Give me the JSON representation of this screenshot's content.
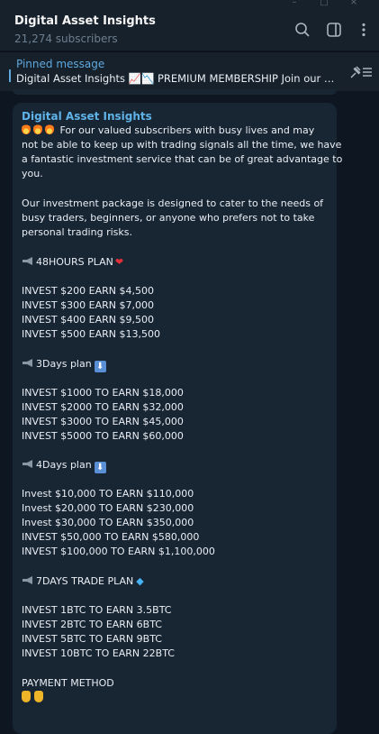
{
  "header": {
    "title": "Digital Asset Insights",
    "subscribers": "21,274 subscribers"
  },
  "pinned": {
    "label": "Pinned message",
    "text": "Digital Asset Insights 📈📉 PREMIUM MEMBERSHIP  Join our VI..."
  },
  "message": {
    "sender": "Digital Asset Insights",
    "intro": [
      "For our valued subscribers with busy lives and may",
      "not be able to keep up with trading signals all the time, we have",
      "a fantastic investment service that can be of great advantage to",
      "you."
    ],
    "package": [
      "Our investment package is designed to cater to the needs of",
      "busy traders, beginners, or anyone who prefers not to take",
      "personal trading risks."
    ],
    "plan48": {
      "title": "48HOURS PLAN",
      "rows": [
        "INVEST $200 EARN $4,500",
        "INVEST $300 EARN $7,000",
        "INVEST $400 EARN $9,500",
        "INVEST $500 EARN $13,500"
      ]
    },
    "plan3": {
      "title": "3Days plan",
      "rows": [
        "INVEST $1000 TO EARN $18,000",
        "INVEST $2000 TO EARN $32,000",
        "INVEST $3000 TO EARN $45,000",
        "INVEST $5000 TO EARN $60,000"
      ]
    },
    "plan4": {
      "title": "4Days plan",
      "rows": [
        "Invest $10,000 TO EARN $110,000",
        "Invest $20,000 TO EARN $230,000",
        "Invest $30,000 TO EARN $350,000",
        "INVEST $50,000 TO EARN $580,000",
        "INVEST $100,000 TO EARN $1,100,000"
      ]
    },
    "plan7": {
      "title": "7DAYS TRADE PLAN",
      "rows": [
        "INVEST 1BTC TO EARN 3.5BTC",
        "INVEST 2BTC TO EARN 6BTC",
        "INVEST 5BTC TO EARN 9BTC",
        "INVEST 10BTC TO EARN 22BTC"
      ]
    },
    "payment": "PAYMENT METHOD"
  },
  "colors": {
    "background": "#0e1621",
    "header": "#17212b",
    "bubble": "#182533",
    "accent": "#5fa8de"
  },
  "icons": [
    "search-icon",
    "sidebar-toggle-icon",
    "more-vertical-icon",
    "unpin-list-icon",
    "fire-emoji",
    "megaphone-emoji",
    "heart-emoji",
    "down-arrow-emoji",
    "gem-emoji",
    "pointing-down-emoji"
  ]
}
